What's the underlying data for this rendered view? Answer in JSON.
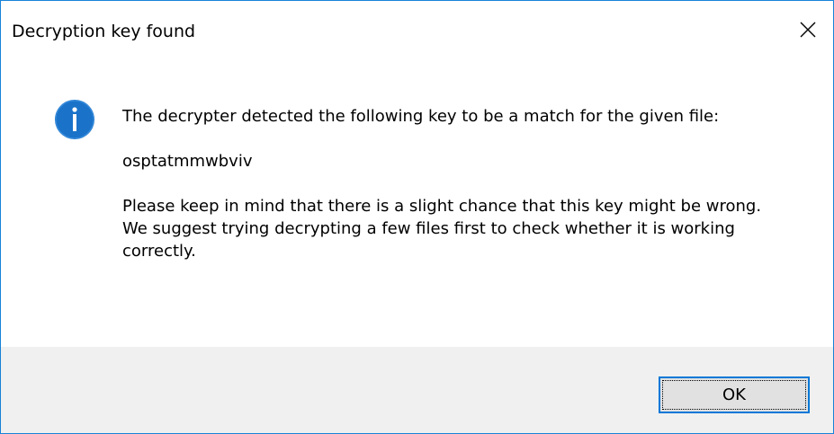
{
  "window": {
    "title": "Decryption key found",
    "close_icon": "close-icon",
    "border_color": "#1883d7"
  },
  "message": {
    "icon": "information-icon",
    "icon_color": "#1a73c9",
    "line1": "The decrypter detected the following key to be a match for the given file:",
    "key": "osptatmmwbviv",
    "warning": "Please keep in mind that there is a slight chance that this key might be wrong. We suggest trying decrypting a few files first to check whether it is working correctly."
  },
  "buttons": {
    "ok_label": "OK",
    "accent_color": "#0078d7"
  }
}
